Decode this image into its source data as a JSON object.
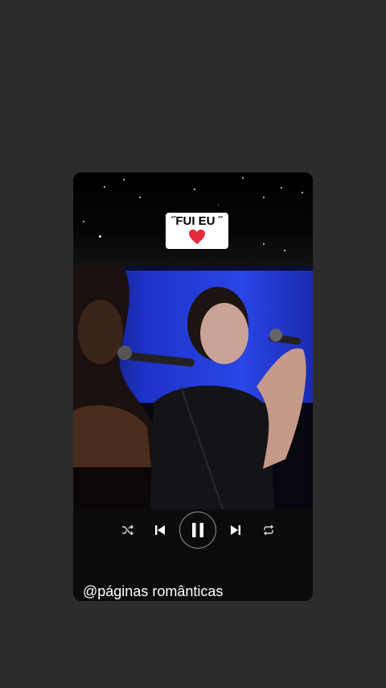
{
  "story": {
    "caption": "˝FUI EU ˝",
    "caption_emoji": "red-heart-icon",
    "handle": "@páginas românticas"
  },
  "player": {
    "controls": [
      "shuffle-icon",
      "previous-icon",
      "pause-icon",
      "next-icon",
      "repeat-icon"
    ],
    "state": "playing"
  },
  "colors": {
    "page_background": "#2d2c2d",
    "card_background": "#0b0b0d",
    "stage_blue": "#1f3bd6",
    "heart": "#e52b3e"
  }
}
